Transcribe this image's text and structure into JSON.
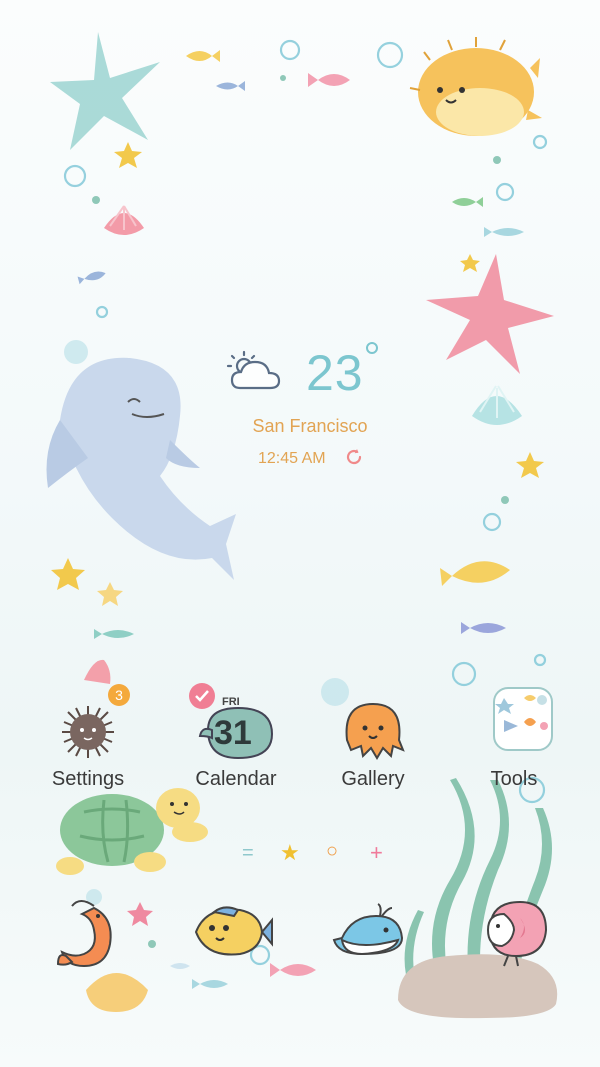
{
  "weather": {
    "temperature": "23",
    "city": "San Francisco",
    "time": "12:45 AM",
    "condition_icon": "partly-cloudy-icon"
  },
  "apps": [
    {
      "label": "Settings",
      "icon": "sea-urchin-icon",
      "badge": "3"
    },
    {
      "label": "Calendar",
      "icon": "snail-calendar-icon",
      "day": "FRI",
      "date": "31"
    },
    {
      "label": "Gallery",
      "icon": "octopus-icon"
    },
    {
      "label": "Tools",
      "icon": "tools-folder-icon"
    }
  ],
  "dock": [
    {
      "name": "shrimp-app"
    },
    {
      "name": "fish-app"
    },
    {
      "name": "whale-app"
    },
    {
      "name": "pink-fish-app"
    }
  ],
  "page_indicator": {
    "symbols": [
      "=",
      "★",
      "○",
      "+"
    ],
    "active_index": 1
  },
  "colors": {
    "temperature": "#7cc6cf",
    "city": "#e2a453",
    "badge": "#f4a93c",
    "label": "#3a3a3a"
  }
}
